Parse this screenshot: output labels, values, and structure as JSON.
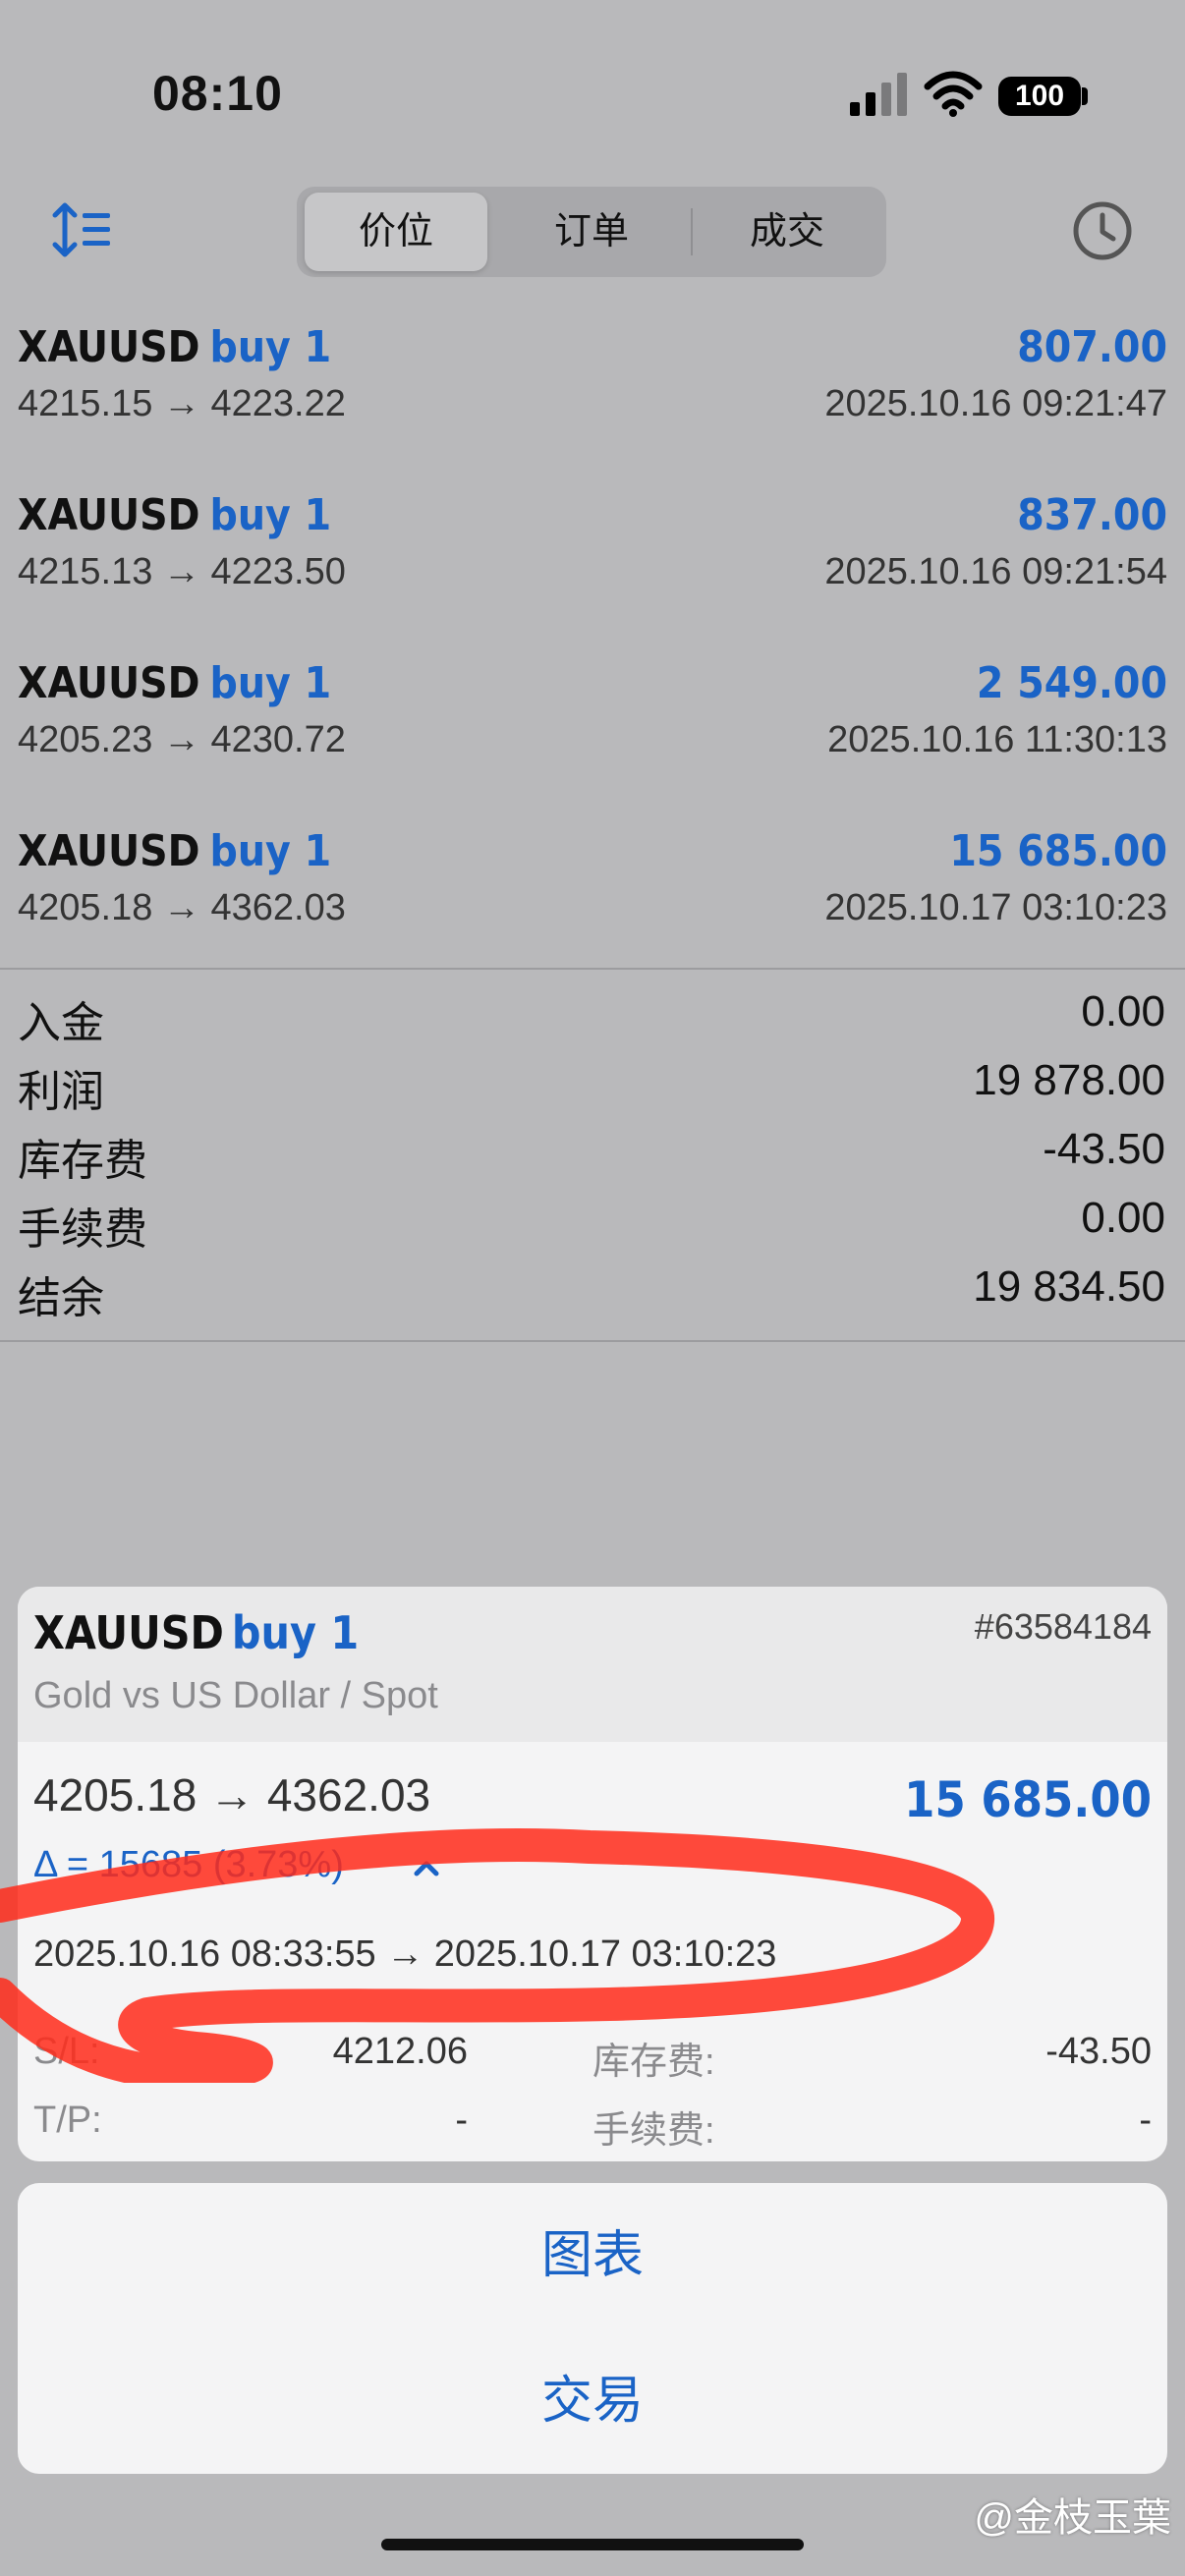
{
  "status_bar": {
    "time": "08:10",
    "battery": "100"
  },
  "tabs": [
    "价位",
    "订单",
    "成交"
  ],
  "trades": [
    {
      "symbol": "XAUUSD",
      "type": "buy 1",
      "profit": "807.00",
      "prices": "4215.15 → 4223.22",
      "time": "2025.10.16 09:21:47"
    },
    {
      "symbol": "XAUUSD",
      "type": "buy 1",
      "profit": "837.00",
      "prices": "4215.13 → 4223.50",
      "time": "2025.10.16 09:21:54"
    },
    {
      "symbol": "XAUUSD",
      "type": "buy 1",
      "profit": "2 549.00",
      "prices": "4205.23 → 4230.72",
      "time": "2025.10.16 11:30:13"
    },
    {
      "symbol": "XAUUSD",
      "type": "buy 1",
      "profit": "15 685.00",
      "prices": "4205.18 → 4362.03",
      "time": "2025.10.17 03:10:23"
    }
  ],
  "summary": [
    {
      "label": "入金",
      "value": "0.00"
    },
    {
      "label": "利润",
      "value": "19 878.00"
    },
    {
      "label": "库存费",
      "value": "-43.50"
    },
    {
      "label": "手续费",
      "value": "0.00"
    },
    {
      "label": "结余",
      "value": "19 834.50"
    }
  ],
  "detail": {
    "symbol": "XAUUSD",
    "type": "buy 1",
    "ticket": "#63584184",
    "description": "Gold vs US Dollar / Spot",
    "prices": "4205.18 → 4362.03",
    "profit": "15 685.00",
    "delta": "Δ = 15685 (3.73%)",
    "times": "2025.10.16 08:33:55 → 2025.10.17 03:10:23",
    "sl_label": "S/L:",
    "sl_value": "4212.06",
    "tp_label": "T/P:",
    "tp_value": "-",
    "swap_label": "库存费:",
    "swap_value": "-43.50",
    "commission_label": "手续费:",
    "commission_value": "-"
  },
  "actions": {
    "chart": "图表",
    "trade": "交易"
  },
  "watermark": "@金枝玉葉",
  "colors": {
    "accent": "#1a63c6",
    "scribble": "#ff2a1a"
  }
}
